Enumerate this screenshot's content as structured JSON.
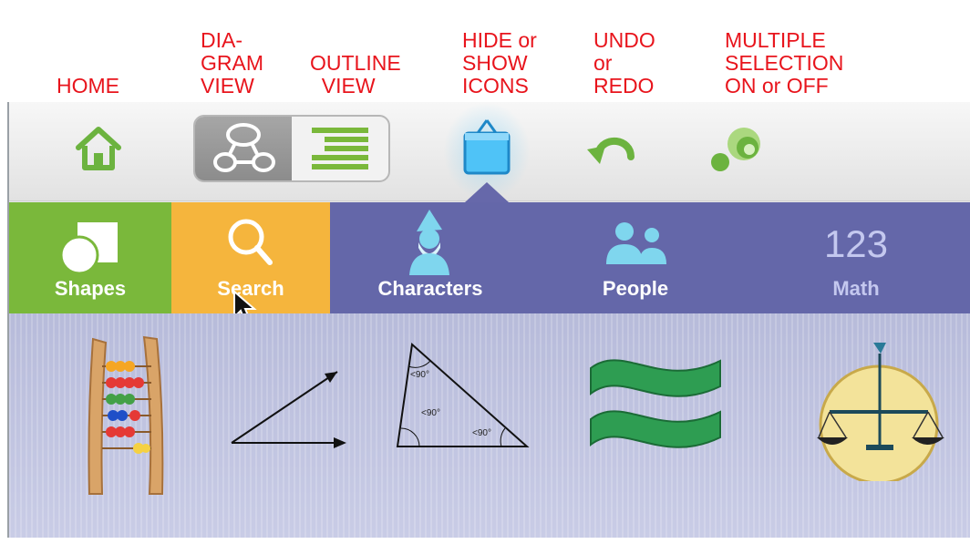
{
  "annotations": {
    "home": "HOME",
    "diagram_view": "DIA-\nGRAM\nVIEW",
    "outline_view": "OUTLINE\n  VIEW",
    "hide_show_icons": "HIDE or\nSHOW\nICONS",
    "undo_redo": "UNDO\nor\nREDO",
    "multiple_selection": "MULTIPLE\nSELECTION\nON or OFF"
  },
  "toolbar": {
    "buttons": [
      "home-icon",
      "diagram-view-icon",
      "outline-view-icon",
      "hide-show-icons-icon",
      "undo-icon",
      "multiple-selection-icon"
    ]
  },
  "tabs": [
    {
      "label": "Shapes",
      "icon": "shapes-icon"
    },
    {
      "label": "Search",
      "icon": "search-icon"
    },
    {
      "label": "Characters",
      "icon": "wizard-icon"
    },
    {
      "label": "People",
      "icon": "people-icon"
    },
    {
      "label": "Math",
      "icon_text": "123"
    }
  ],
  "panel_items": [
    {
      "icon": "abacus-icon"
    },
    {
      "icon": "angle-icon"
    },
    {
      "icon": "triangle-icon",
      "angle_labels": [
        "<90°",
        "<90°",
        "<90°"
      ]
    },
    {
      "icon": "approximately-equal-icon"
    },
    {
      "icon": "balance-scale-icon"
    }
  ],
  "colors": {
    "annotation": "#e8141c",
    "tab_shapes": "#7ab83b",
    "tab_search": "#f5b53d",
    "tab_bar": "#6467a9",
    "icon_green": "#6cb33f",
    "icon_blue": "#4fc3f7"
  }
}
